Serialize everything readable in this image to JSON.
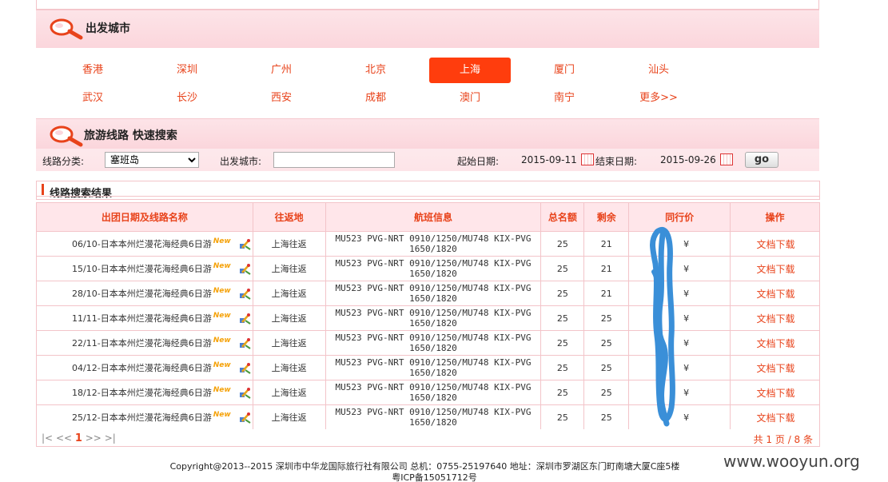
{
  "departure": {
    "title": "出发城市"
  },
  "cities": [
    {
      "name": "香港",
      "active": false
    },
    {
      "name": "深圳",
      "active": false
    },
    {
      "name": "广州",
      "active": false
    },
    {
      "name": "北京",
      "active": false
    },
    {
      "name": "上海",
      "active": true
    },
    {
      "name": "厦门",
      "active": false
    },
    {
      "name": "汕头",
      "active": false
    },
    {
      "name": "武汉",
      "active": false
    },
    {
      "name": "长沙",
      "active": false
    },
    {
      "name": "西安",
      "active": false
    },
    {
      "name": "成都",
      "active": false
    },
    {
      "name": "澳门",
      "active": false
    },
    {
      "name": "南宁",
      "active": false
    },
    {
      "name": "更多>>",
      "active": false
    }
  ],
  "search": {
    "title": "旅游线路 快速搜索",
    "category_label": "线路分类:",
    "category_value": "塞班岛",
    "city_label": "出发城市:",
    "city_value": "",
    "start_label": "起始日期:",
    "start_value": "2015-09-11",
    "end_label": "结束日期:",
    "end_value": "2015-09-26",
    "go_label": "go"
  },
  "results": {
    "title": "线路搜索结果",
    "columns": [
      "出团日期及线路名称",
      "往返地",
      "航班信息",
      "总名额",
      "剩余",
      "同行价",
      "操作"
    ],
    "new_tag": "New",
    "rows": [
      {
        "name": "06/10-日本本州烂漫花海经典6日游",
        "route": "上海往返",
        "flight1": "MU523 PVG-NRT 0910/1250/MU748 KIX-PVG",
        "flight2": "1650/1820",
        "total": "25",
        "left": "21",
        "price": "¥",
        "op": "文档下载"
      },
      {
        "name": "15/10-日本本州烂漫花海经典6日游",
        "route": "上海往返",
        "flight1": "MU523 PVG-NRT 0910/1250/MU748 KIX-PVG",
        "flight2": "1650/1820",
        "total": "25",
        "left": "21",
        "price": "¥",
        "op": "文档下载"
      },
      {
        "name": "28/10-日本本州烂漫花海经典6日游",
        "route": "上海往返",
        "flight1": "MU523 PVG-NRT 0910/1250/MU748 KIX-PVG",
        "flight2": "1650/1820",
        "total": "25",
        "left": "21",
        "price": "¥",
        "op": "文档下载"
      },
      {
        "name": "11/11-日本本州烂漫花海经典6日游",
        "route": "上海往返",
        "flight1": "MU523 PVG-NRT 0910/1250/MU748 KIX-PVG",
        "flight2": "1650/1820",
        "total": "25",
        "left": "25",
        "price": "¥",
        "op": "文档下载"
      },
      {
        "name": "22/11-日本本州烂漫花海经典6日游",
        "route": "上海往返",
        "flight1": "MU523 PVG-NRT 0910/1250/MU748 KIX-PVG",
        "flight2": "1650/1820",
        "total": "25",
        "left": "25",
        "price": "¥",
        "op": "文档下载"
      },
      {
        "name": "04/12-日本本州烂漫花海经典6日游",
        "route": "上海往返",
        "flight1": "MU523 PVG-NRT 0910/1250/MU748 KIX-PVG",
        "flight2": "1650/1820",
        "total": "25",
        "left": "25",
        "price": "¥",
        "op": "文档下载"
      },
      {
        "name": "18/12-日本本州烂漫花海经典6日游",
        "route": "上海往返",
        "flight1": "MU523 PVG-NRT 0910/1250/MU748 KIX-PVG",
        "flight2": "1650/1820",
        "total": "25",
        "left": "25",
        "price": "¥",
        "op": "文档下载"
      },
      {
        "name": "25/12-日本本州烂漫花海经典6日游",
        "route": "上海往返",
        "flight1": "MU523 PVG-NRT 0910/1250/MU748 KIX-PVG",
        "flight2": "1650/1820",
        "total": "25",
        "left": "25",
        "price": "¥",
        "op": "文档下载"
      }
    ]
  },
  "pager": {
    "first": "|<",
    "prev": "<<",
    "current": "1",
    "next": ">>",
    "last": ">|",
    "total": "共 1 页 / 8 条"
  },
  "footer": {
    "line1": "Copyright@2013--2015 深圳市中华龙国际旅行社有限公司 总机：0755-25197640 地址：深圳市罗湖区东门町南塘大厦C座5楼",
    "line2": "粤ICP备15051712号"
  },
  "watermark": "www.wooyun.org",
  "colors": {
    "accent": "#e8431b",
    "active_city": "#ff3d0d",
    "header_pink": "#fde4e8",
    "border_pink": "#f3c4c9",
    "redaction": "#3a8fd8"
  }
}
